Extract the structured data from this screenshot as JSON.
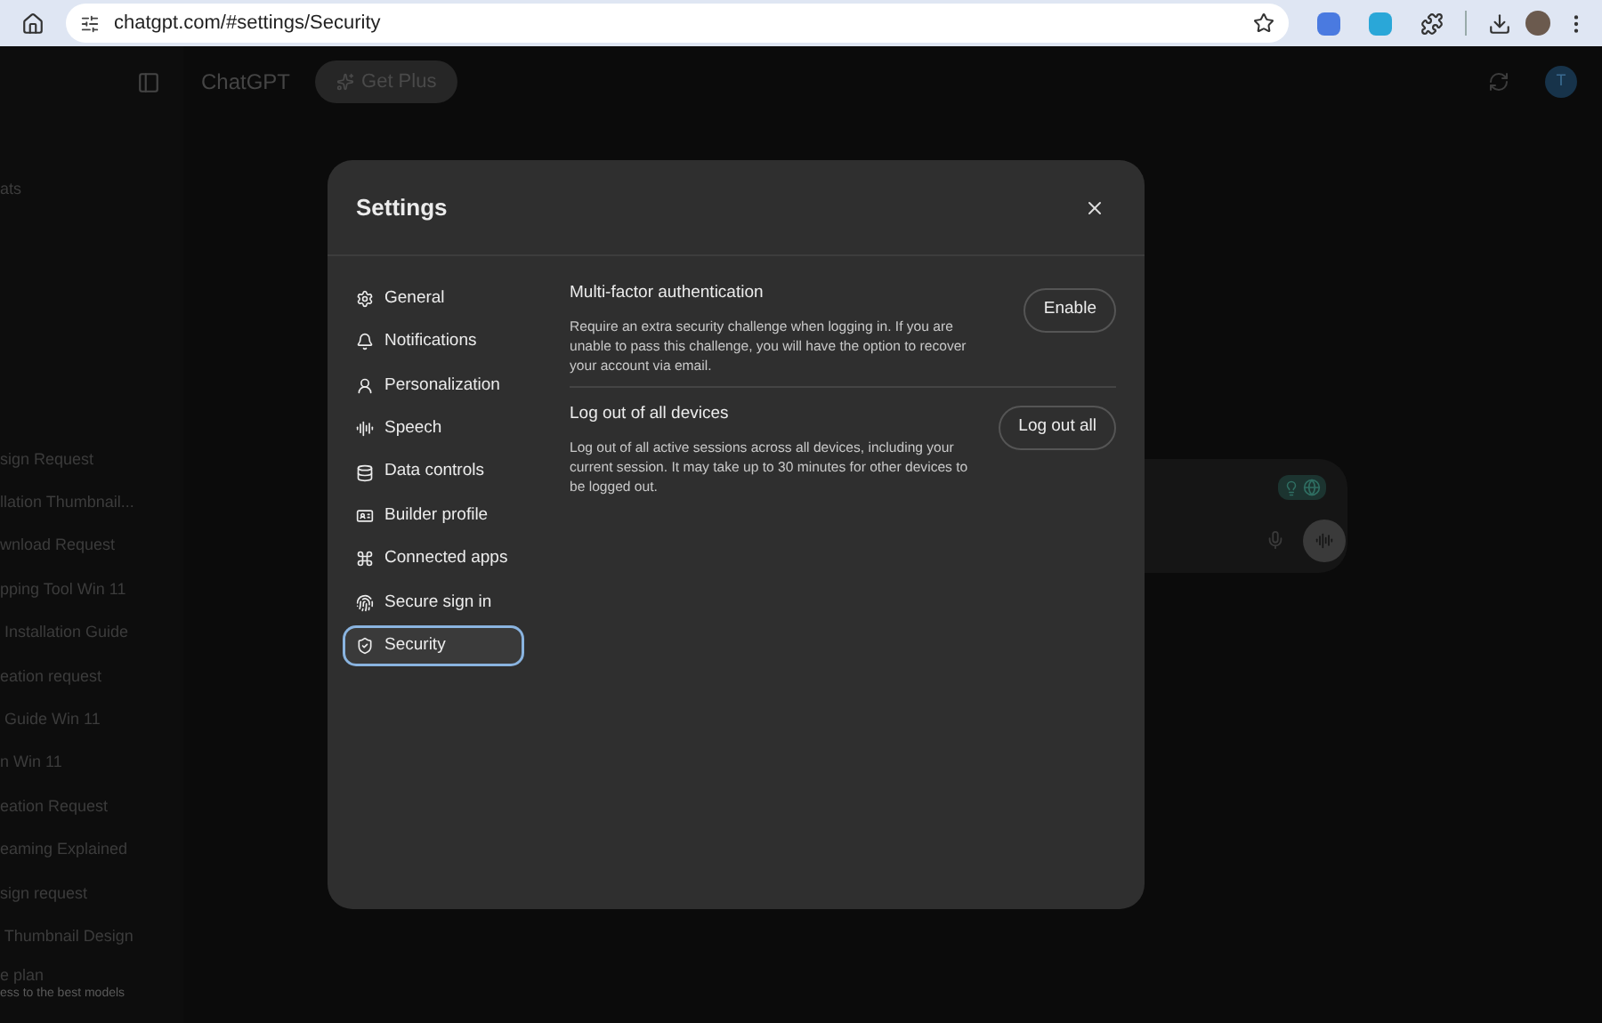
{
  "browser": {
    "url": "chatgpt.com/#settings/Security"
  },
  "header": {
    "title": "ChatGPT",
    "upgrade_button": "Get Plus",
    "avatar": "T"
  },
  "sidebar": {
    "items": [
      {
        "label": "ats"
      },
      {
        "label": "sign Request"
      },
      {
        "label": "llation Thumbnail..."
      },
      {
        "label": "wnload Request"
      },
      {
        "label": "pping Tool Win 11"
      },
      {
        "label": " Installation Guide"
      },
      {
        "label": "eation request"
      },
      {
        "label": " Guide Win 11"
      },
      {
        "label": "n Win 11"
      },
      {
        "label": "eation Request"
      },
      {
        "label": "eaming Explained"
      },
      {
        "label": "sign request"
      },
      {
        "label": " Thumbnail Design"
      }
    ],
    "plan": {
      "title": "e plan",
      "subtitle": "ess to the best models"
    }
  },
  "settings": {
    "title": "Settings",
    "nav": [
      {
        "label": "General",
        "selected": false
      },
      {
        "label": "Notifications",
        "selected": false
      },
      {
        "label": "Personalization",
        "selected": false
      },
      {
        "label": "Speech",
        "selected": false
      },
      {
        "label": "Data controls",
        "selected": false
      },
      {
        "label": "Builder profile",
        "selected": false
      },
      {
        "label": "Connected apps",
        "selected": false
      },
      {
        "label": "Secure sign in",
        "selected": false
      },
      {
        "label": "Security",
        "selected": true
      }
    ],
    "sections": [
      {
        "title": "Multi-factor authentication",
        "description": "Require an extra security challenge when logging in. If you are unable to pass this challenge, you will have the option to recover your account via email.",
        "button": "Enable"
      },
      {
        "title": "Log out of all devices",
        "description": "Log out of all active sessions across all devices, including your current session. It may take up to 30 minutes for other devices to be logged out.",
        "button": "Log out all"
      }
    ]
  }
}
